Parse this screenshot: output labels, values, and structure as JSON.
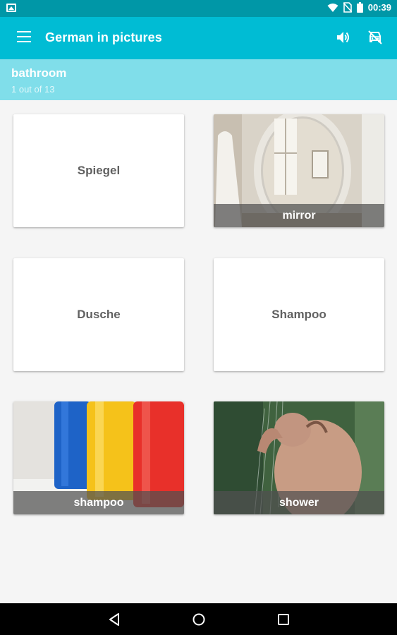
{
  "status": {
    "time": "00:39",
    "icons": [
      "gallery-icon",
      "wifi-icon",
      "no-sim-icon",
      "battery-icon"
    ]
  },
  "app_bar": {
    "title": "German in pictures",
    "actions": [
      "sound-icon",
      "car-off-icon"
    ]
  },
  "sub_header": {
    "category": "bathroom",
    "progress": "1 out of 13"
  },
  "cards": [
    {
      "type": "word",
      "text": "Spiegel"
    },
    {
      "type": "image",
      "label": "mirror"
    },
    {
      "type": "word",
      "text": "Dusche"
    },
    {
      "type": "word",
      "text": "Shampoo"
    },
    {
      "type": "image",
      "label": "shampoo"
    },
    {
      "type": "image",
      "label": "shower"
    }
  ],
  "colors": {
    "status_bar": "#0097a7",
    "app_bar": "#00bcd4",
    "sub_header": "#80deea",
    "background": "#f5f5f5"
  },
  "nav": [
    "back-icon",
    "home-icon",
    "recents-icon"
  ]
}
